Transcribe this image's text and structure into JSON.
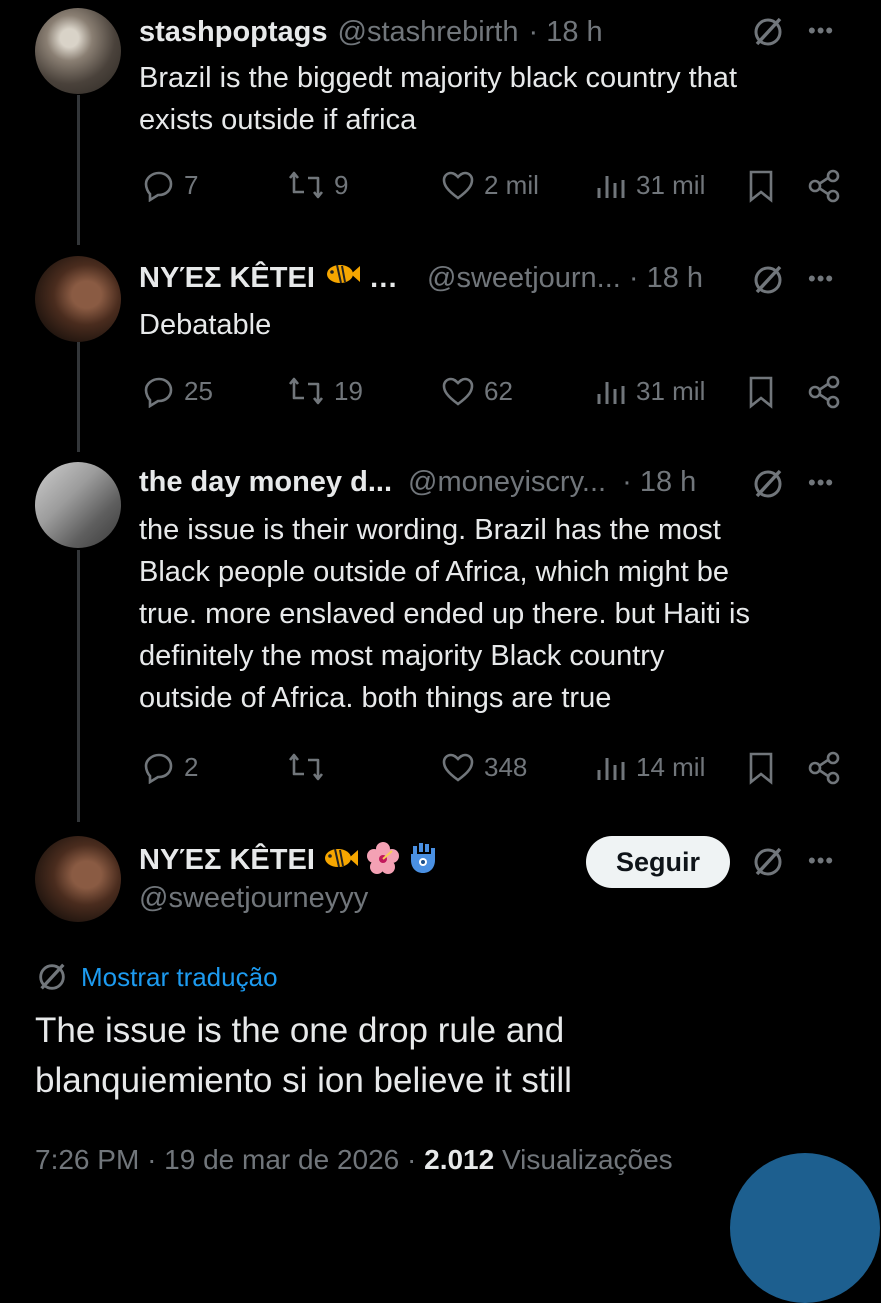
{
  "tweets": [
    {
      "name": "stashpoptags",
      "handle": "@stashrebirth",
      "time": "· 18 h",
      "text_lines": [
        "Brazil is the biggedt majority black country that",
        "exists outside if africa"
      ],
      "stats": {
        "replies": "7",
        "retweets": "9",
        "likes": "2 mil",
        "views": "31 mil"
      }
    },
    {
      "name": "NYΈΣ KÊTEI",
      "name_trunc": "…",
      "handle": "@sweetjourn...",
      "time": "· 18 h",
      "text_lines": [
        "Debatable"
      ],
      "stats": {
        "replies": "25",
        "retweets": "19",
        "likes": "62",
        "views": "31 mil"
      }
    },
    {
      "name": "the day money d...",
      "handle": "@moneyiscry...",
      "time": "· 18 h",
      "text_lines": [
        "the issue is their wording. Brazil has the most",
        "Black people outside of Africa, which might be",
        "true. more enslaved ended up there. but Haiti is",
        "definitely the most majority Black country",
        "outside of Africa. both things are true"
      ],
      "stats": {
        "replies": "2",
        "retweets": "",
        "likes": "348",
        "views": "14 mil"
      }
    }
  ],
  "main_post": {
    "name": "NYΈΣ KÊTEI",
    "handle": "@sweetjourneyyy",
    "follow_label": "Seguir",
    "translate_label": "Mostrar tradução",
    "text_lines": [
      "The issue is the one drop rule and",
      "blanquiemiento si ion believe it still"
    ],
    "time": "7:26 PM",
    "date": "19 de mar de 2026",
    "views_count": "2.012",
    "views_label": "Visualizações"
  },
  "colors": {
    "background": "#000000",
    "text": "#e7e9ea",
    "muted": "#71767b",
    "accent": "#1d9bf0",
    "thread_line": "#333639"
  },
  "icons": [
    "grok-icon",
    "more-icon",
    "reply-icon",
    "retweet-icon",
    "like-icon",
    "views-icon",
    "bookmark-icon",
    "share-icon",
    "fish-emoji",
    "hibiscus-emoji",
    "hamsa-emoji"
  ]
}
